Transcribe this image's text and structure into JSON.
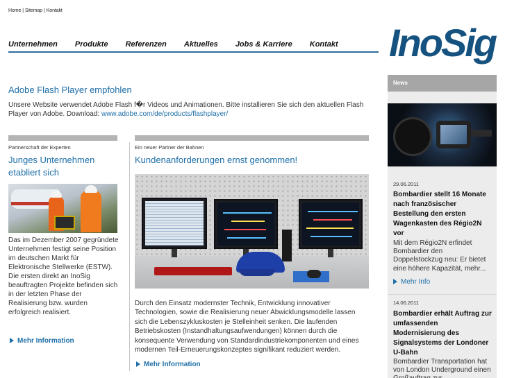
{
  "toplinks": [
    "Home",
    "Sitemap",
    "Kontakt"
  ],
  "nav": [
    "Unternehmen",
    "Produkte",
    "Referenzen",
    "Aktuelles",
    "Jobs & Karriere",
    "Kontakt"
  ],
  "logo": "InoSig",
  "flash": {
    "title": "Adobe Flash Player empfohlen",
    "text": "Unsere Website verwendet Adobe Flash f�r Videos und Animationen. Bitte installieren Sie sich den aktuellen Flash Player von Adobe. Download: ",
    "link": "www.adobe.com/de/products/flashplayer/"
  },
  "left": {
    "kicker": "Partnerschaft der Experten",
    "title": "Junges Unternehmen etabliert sich",
    "text": "Das im Dezember 2007 gegründete Unternehmen festigt seine Position im deutschen Markt für Elektronische Stellwerke (ESTW). Die ersten direkt an InoSig beauftragten Projekte befinden sich in der letzten Phase der Realisierung bzw. wurden erfolgreich realisiert.",
    "more": "Mehr Information"
  },
  "middle": {
    "kicker": "Ein neuer Partner der Bahnen",
    "title": "Kundenanforderungen ernst genommen!",
    "text": "Durch den Einsatz modernster Technik, Entwicklung innovativer Technologien, sowie die Realisierung neuer Abwicklungsmodelle lassen sich die Lebenszykluskosten je Stelleinheit senken. Die laufenden Betriebskosten (Instandhaltungsaufwendungen) können durch die konsequente Verwendung von Standardindustriekomponenten und eines modernen Teil-Erneuerungskonzeptes  signifikant reduziert werden.",
    "more": "Mehr Information"
  },
  "news": {
    "header": "News",
    "items": [
      {
        "date": "29.06.2011",
        "title": "Bombardier stellt 16 Monate nach französischer Bestellung den ersten Wagenkasten des Régio2N vor",
        "body": "Mit dem Régio2N erfindet Bombardier den Doppelstockzug neu: Er bietet eine höhere Kapazität, mehr...",
        "more": "Mehr Info"
      },
      {
        "date": "14.06.2011",
        "title": "Bombardier erhält Auftrag zur umfassenden Modernisierung des Signalsystems der Londoner U-Bahn",
        "body": "Bombardier Transportation hat von London Underground einen Großauftrag zur"
      }
    ]
  }
}
